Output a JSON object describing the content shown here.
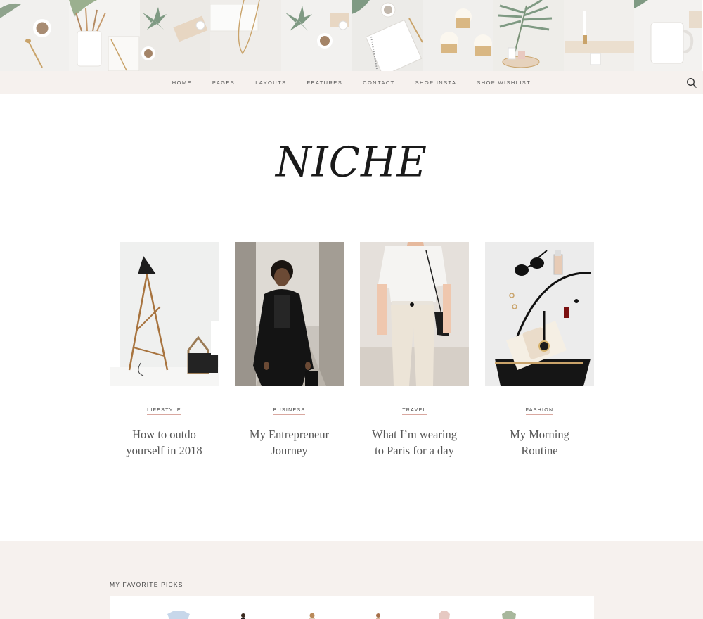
{
  "instagram": {
    "tiles": [
      "coffee-and-leaves-photo",
      "pencil-cup-photo",
      "succulent-desk-photo",
      "marble-necklace-photo",
      "succulent-coffee-photo",
      "notebook-photo",
      "cupcakes-photo",
      "palm-leaf-photo",
      "candle-tray-photo",
      "white-mug-photo"
    ]
  },
  "nav": {
    "items": [
      "HOME",
      "PAGES",
      "LAYOUTS",
      "FEATURES",
      "CONTACT",
      "SHOP INSTA",
      "SHOP WISHLIST"
    ],
    "search_icon": "search-icon"
  },
  "site": {
    "logo": "NICHE"
  },
  "posts": [
    {
      "category": "LIFESTYLE",
      "title": "How to outdo yourself in 2018",
      "image": "floor-lamp-photo"
    },
    {
      "category": "BUSINESS",
      "title": "My Entrepreneur Journey",
      "image": "woman-street-photo"
    },
    {
      "category": "TRAVEL",
      "title": "What I’m wearing to Paris for a day",
      "image": "white-outfit-photo"
    },
    {
      "category": "FASHION",
      "title": "My Morning Routine",
      "image": "handbag-flatlay-photo"
    }
  ],
  "picks": {
    "heading": "MY FAVORITE PICKS",
    "items": [
      "pick-item-1",
      "pick-item-2",
      "pick-item-3",
      "pick-item-4",
      "pick-item-5",
      "pick-item-6"
    ]
  },
  "colors": {
    "nav_bg": "#f6f1ee",
    "category_underline": "#d9a8a0",
    "logo": "#1a1a1a"
  }
}
